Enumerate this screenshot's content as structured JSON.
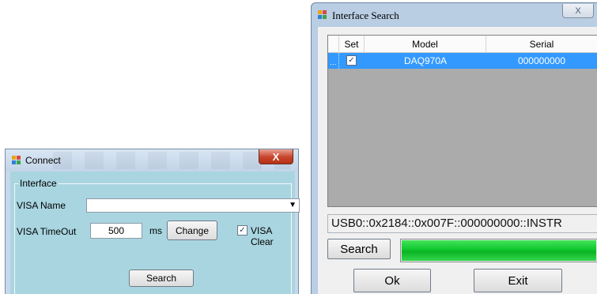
{
  "connect": {
    "title": "Connect",
    "close_glyph": "X",
    "group_label": "Interface",
    "visa_name_label": "VISA Name",
    "visa_name_value": "",
    "timeout_label": "VISA TimeOut",
    "timeout_value": "500",
    "timeout_unit": "ms",
    "change_label": "Change",
    "visa_clear_label": "VISA Clear",
    "visa_clear_checked": true,
    "search_label": "Search"
  },
  "interface_search": {
    "title": "Interface Search",
    "close_glyph": "X",
    "columns": [
      "Set",
      "Model",
      "Serial"
    ],
    "rows": [
      {
        "set": true,
        "model": "DAQ970A",
        "serial": "000000000"
      }
    ],
    "resource_string": "USB0::0x2184::0x007F::000000000::INSTR",
    "search_label": "Search",
    "progress": 1.0,
    "ok_label": "Ok",
    "exit_label": "Exit"
  },
  "icons": {
    "check": "✓",
    "dropdown": "▼",
    "row_marker": "…"
  },
  "colors": {
    "selection": "#3399ff",
    "progress": "#10c72d",
    "connect_panel": "#a9d5e0"
  }
}
